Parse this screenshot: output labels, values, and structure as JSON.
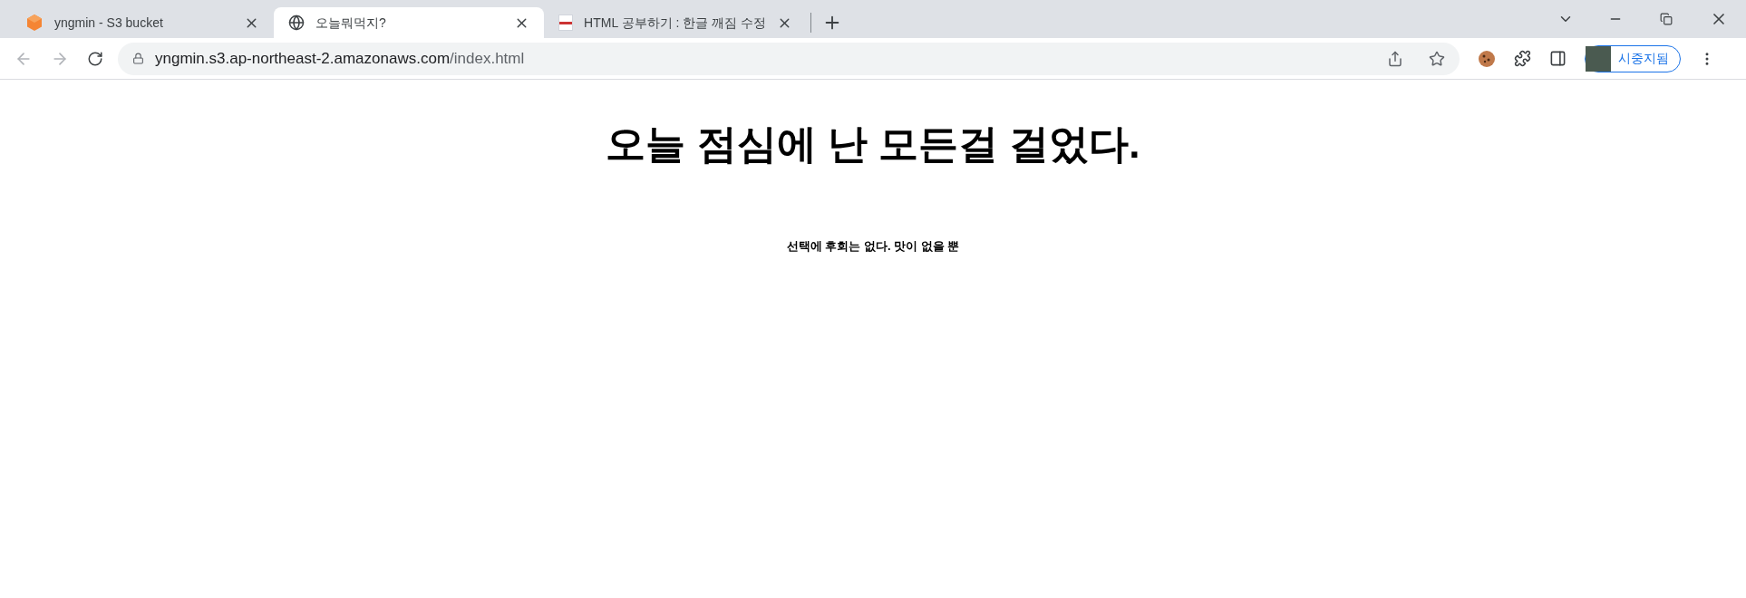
{
  "tabs": [
    {
      "title": "yngmin - S3 bucket",
      "kind": "cube",
      "selected": false
    },
    {
      "title": "오늘뭐먹지?",
      "kind": "globe",
      "selected": true
    },
    {
      "title": "HTML 공부하기 : 한글 깨짐 수정",
      "kind": "thumb",
      "selected": false
    }
  ],
  "address_bar": {
    "host": "yngmin.s3.ap-northeast-2.amazonaws.com",
    "path": "/index.html"
  },
  "profile": {
    "label": "시중지됨"
  },
  "page": {
    "heading": "오늘 점심에 난 모든걸 걸었다.",
    "text": "선택에 후회는 없다. 맛이 없을 뿐"
  }
}
